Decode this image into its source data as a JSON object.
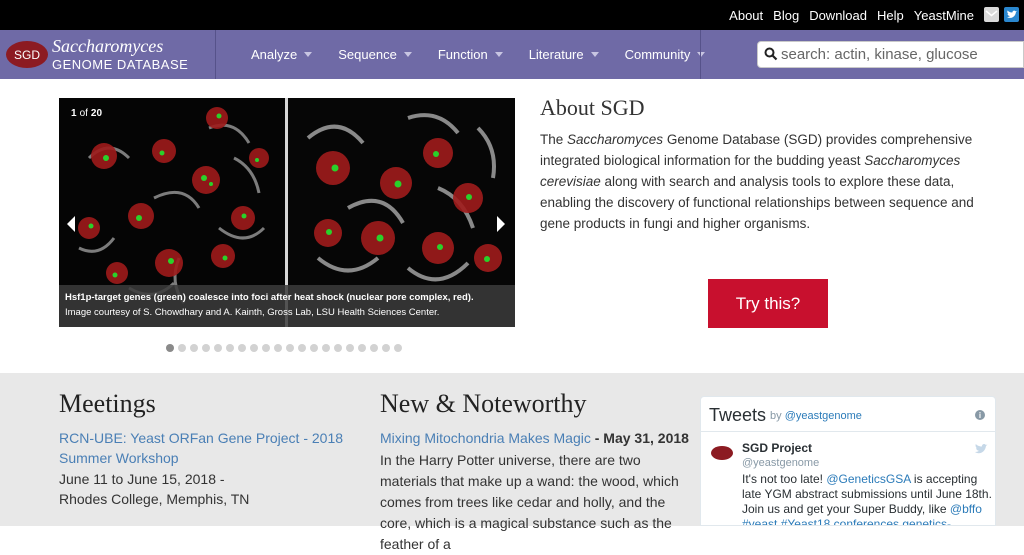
{
  "topbar": {
    "links": [
      "About",
      "Blog",
      "Download",
      "Help",
      "YeastMine"
    ],
    "icons": [
      "mail-icon",
      "twitter-icon"
    ]
  },
  "brand": {
    "oval": "SGD",
    "title": "Saccharomyces",
    "subtitle": "GENOME DATABASE",
    "color": "#6f6aa6",
    "accent": "#8c1b22"
  },
  "nav": {
    "items": [
      "Analyze",
      "Sequence",
      "Function",
      "Literature",
      "Community"
    ]
  },
  "search": {
    "placeholder": "search: actin, kinase, glucose"
  },
  "carousel": {
    "current": "1",
    "of": "of",
    "total": "20",
    "caption": "Hsf1p-target genes (green) coalesce into foci after heat shock (nuclear pore complex, red).",
    "credit": "Image courtesy of S. Chowdhary and A. Kainth, Gross Lab, LSU Health Sciences Center.",
    "slide_count": 20,
    "active_index": 0
  },
  "about": {
    "title": "About SGD",
    "p1": "The ",
    "p2": "Saccharomyces",
    "p3": " Genome Database (SGD) provides comprehensive integrated biological information for the budding yeast ",
    "p4": "Saccharomyces cerevisiae",
    "p5": " along with search and analysis tools to explore these data, enabling the discovery of functional relationships between sequence and gene products in fungi and higher organisms.",
    "button": "Try this?",
    "button_color": "#c8102e"
  },
  "meetings": {
    "title": "Meetings",
    "link": "RCN-UBE: Yeast ORFan Gene Project - 2018 Summer Workshop",
    "date": "June 11 to June 15, 2018 -",
    "location": "Rhodes College, Memphis, TN"
  },
  "news": {
    "title": "New & Noteworthy",
    "link": "Mixing Mitochondria Makes Magic",
    "date": " - May 31, 2018",
    "body": "In the Harry Potter universe, there are two materials that make up a wand: the wood, which comes from trees like cedar and holly, and the core, which is a magical substance such as the feather of a"
  },
  "tweets": {
    "title": "Tweets",
    "by": "by ",
    "by_handle": "@yeastgenome",
    "name": "SGD Project",
    "handle": "@yeastgenome",
    "t1": "It's not too late! ",
    "t2": "@GeneticsGSA",
    "t3": " is accepting late YGM abstract submissions until June 18th. Join us and get your Super Buddy, like ",
    "t4": "@bffo",
    "t5": " ",
    "t6": "#yeast",
    "t7": " ",
    "t8": "#Yeast18",
    "t9": " ",
    "t10": "conferences.genetics-"
  }
}
